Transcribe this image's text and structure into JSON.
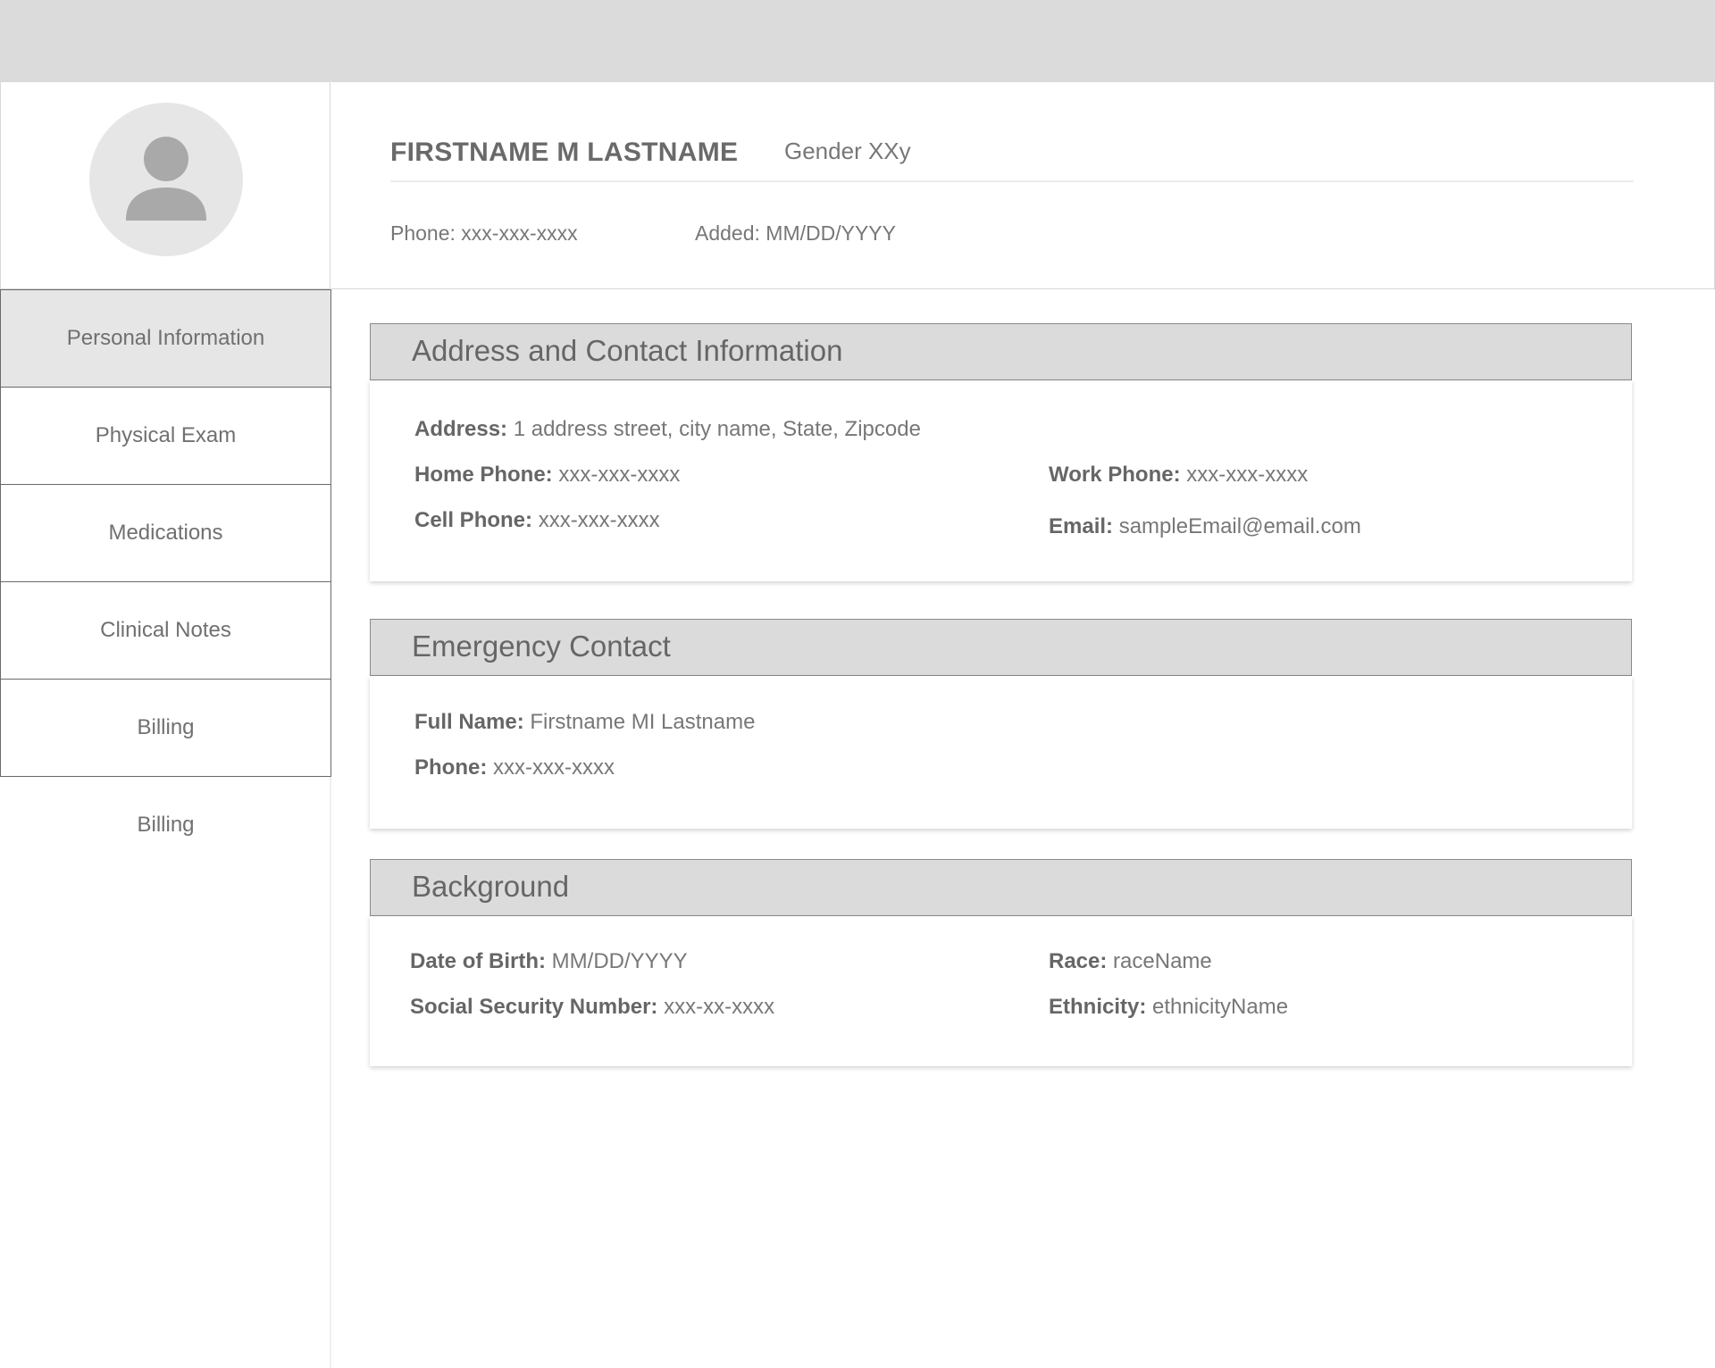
{
  "colors": {
    "topbar": "#dcdbdc",
    "section_header": "#dcdbdc",
    "active_nav": "#e7e6e7",
    "text": "#6f6f6f"
  },
  "header": {
    "avatar_icon": "user-placeholder-icon",
    "name": "FIRSTNAME M LASTNAME",
    "gender": "Gender XXy",
    "phone": "Phone: xxx-xxx-xxxx",
    "added": "Added: MM/DD/YYYY"
  },
  "sidebar": {
    "items": [
      {
        "label": "Personal Information",
        "active": true
      },
      {
        "label": "Physical Exam"
      },
      {
        "label": "Medications"
      },
      {
        "label": "Clinical Notes"
      },
      {
        "label": "Billing"
      },
      {
        "label": "Billing"
      }
    ]
  },
  "address_section": {
    "title": "Address and Contact Information",
    "address_label": "Address:",
    "address_value": "1 address street, city name, State, Zipcode",
    "home_phone_label": "Home Phone:",
    "home_phone_value": "xxx-xxx-xxxx",
    "work_phone_label": "Work Phone:",
    "work_phone_value": "xxx-xxx-xxxx",
    "cell_phone_label": "Cell Phone:",
    "cell_phone_value": "xxx-xxx-xxxx",
    "email_label": "Email:",
    "email_value": "sampleEmail@email.com"
  },
  "emergency_section": {
    "title": "Emergency Contact",
    "full_name_label": "Full Name:",
    "full_name_value": "Firstname MI Lastname",
    "phone_label": "Phone:",
    "phone_value": "xxx-xxx-xxxx"
  },
  "background_section": {
    "title": "Background",
    "dob_label": "Date of Birth:",
    "dob_value": "MM/DD/YYYY",
    "ssn_label": "Social Security Number:",
    "ssn_value": "xxx-xx-xxxx",
    "race_label": "Race:",
    "race_value": "raceName",
    "ethnicity_label": "Ethnicity:",
    "ethnicity_value": "ethnicityName"
  }
}
